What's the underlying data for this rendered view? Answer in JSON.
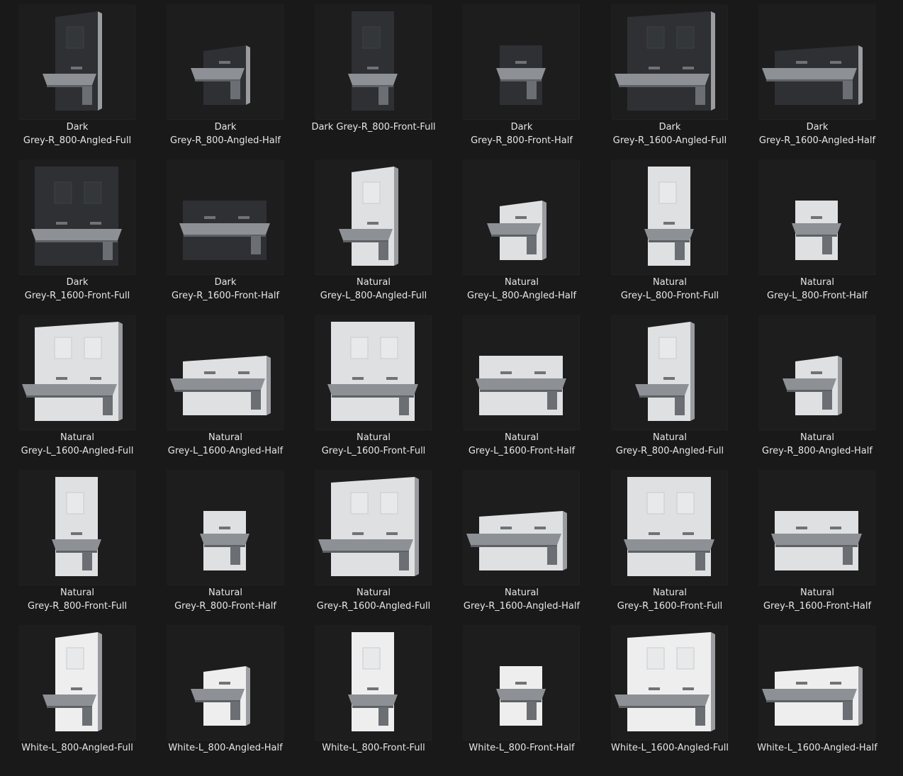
{
  "colors": {
    "background": "#191919",
    "thumbnail": "#1d1d1d",
    "label_text": "#e6e6e6",
    "dark_grey_panel": "#2e3033",
    "natural_grey_panel": "#dfe0e2",
    "white_panel": "#eeeeee",
    "steel": "#8d9094"
  },
  "items": [
    {
      "label": "Dark\nGrey-R_800-Angled-Full",
      "finish": "dark",
      "width": "800",
      "view": "angled",
      "height": "full"
    },
    {
      "label": "Dark\nGrey-R_800-Angled-Half",
      "finish": "dark",
      "width": "800",
      "view": "angled",
      "height": "half"
    },
    {
      "label": "Dark Grey-R_800-Front-Full",
      "finish": "dark",
      "width": "800",
      "view": "front",
      "height": "full"
    },
    {
      "label": "Dark\nGrey-R_800-Front-Half",
      "finish": "dark",
      "width": "800",
      "view": "front",
      "height": "half"
    },
    {
      "label": "Dark\nGrey-R_1600-Angled-Full",
      "finish": "dark",
      "width": "1600",
      "view": "angled",
      "height": "full"
    },
    {
      "label": "Dark\nGrey-R_1600-Angled-Half",
      "finish": "dark",
      "width": "1600",
      "view": "angled",
      "height": "half"
    },
    {
      "label": "Dark\nGrey-R_1600-Front-Full",
      "finish": "dark",
      "width": "1600",
      "view": "front",
      "height": "full"
    },
    {
      "label": "Dark\nGrey-R_1600-Front-Half",
      "finish": "dark",
      "width": "1600",
      "view": "front",
      "height": "half"
    },
    {
      "label": "Natural\nGrey-L_800-Angled-Full",
      "finish": "natural",
      "width": "800",
      "view": "angled",
      "height": "full"
    },
    {
      "label": "Natural\nGrey-L_800-Angled-Half",
      "finish": "natural",
      "width": "800",
      "view": "angled",
      "height": "half"
    },
    {
      "label": "Natural\nGrey-L_800-Front-Full",
      "finish": "natural",
      "width": "800",
      "view": "front",
      "height": "full"
    },
    {
      "label": "Natural\nGrey-L_800-Front-Half",
      "finish": "natural",
      "width": "800",
      "view": "front",
      "height": "half"
    },
    {
      "label": "Natural\nGrey-L_1600-Angled-Full",
      "finish": "natural",
      "width": "1600",
      "view": "angled",
      "height": "full"
    },
    {
      "label": "Natural\nGrey-L_1600-Angled-Half",
      "finish": "natural",
      "width": "1600",
      "view": "angled",
      "height": "half"
    },
    {
      "label": "Natural\nGrey-L_1600-Front-Full",
      "finish": "natural",
      "width": "1600",
      "view": "front",
      "height": "full"
    },
    {
      "label": "Natural\nGrey-L_1600-Front-Half",
      "finish": "natural",
      "width": "1600",
      "view": "front",
      "height": "half"
    },
    {
      "label": "Natural\nGrey-R_800-Angled-Full",
      "finish": "natural",
      "width": "800",
      "view": "angled",
      "height": "full"
    },
    {
      "label": "Natural\nGrey-R_800-Angled-Half",
      "finish": "natural",
      "width": "800",
      "view": "angled",
      "height": "half"
    },
    {
      "label": "Natural\nGrey-R_800-Front-Full",
      "finish": "natural",
      "width": "800",
      "view": "front",
      "height": "full"
    },
    {
      "label": "Natural\nGrey-R_800-Front-Half",
      "finish": "natural",
      "width": "800",
      "view": "front",
      "height": "half"
    },
    {
      "label": "Natural\nGrey-R_1600-Angled-Full",
      "finish": "natural",
      "width": "1600",
      "view": "angled",
      "height": "full"
    },
    {
      "label": "Natural\nGrey-R_1600-Angled-Half",
      "finish": "natural",
      "width": "1600",
      "view": "angled",
      "height": "half"
    },
    {
      "label": "Natural\nGrey-R_1600-Front-Full",
      "finish": "natural",
      "width": "1600",
      "view": "front",
      "height": "full"
    },
    {
      "label": "Natural\nGrey-R_1600-Front-Half",
      "finish": "natural",
      "width": "1600",
      "view": "front",
      "height": "half"
    },
    {
      "label": "White-L_800-Angled-Full",
      "finish": "white",
      "width": "800",
      "view": "angled",
      "height": "full"
    },
    {
      "label": "White-L_800-Angled-Half",
      "finish": "white",
      "width": "800",
      "view": "angled",
      "height": "half"
    },
    {
      "label": "White-L_800-Front-Full",
      "finish": "white",
      "width": "800",
      "view": "front",
      "height": "full"
    },
    {
      "label": "White-L_800-Front-Half",
      "finish": "white",
      "width": "800",
      "view": "front",
      "height": "half"
    },
    {
      "label": "White-L_1600-Angled-Full",
      "finish": "white",
      "width": "1600",
      "view": "angled",
      "height": "full"
    },
    {
      "label": "White-L_1600-Angled-Half",
      "finish": "white",
      "width": "1600",
      "view": "angled",
      "height": "half"
    }
  ]
}
